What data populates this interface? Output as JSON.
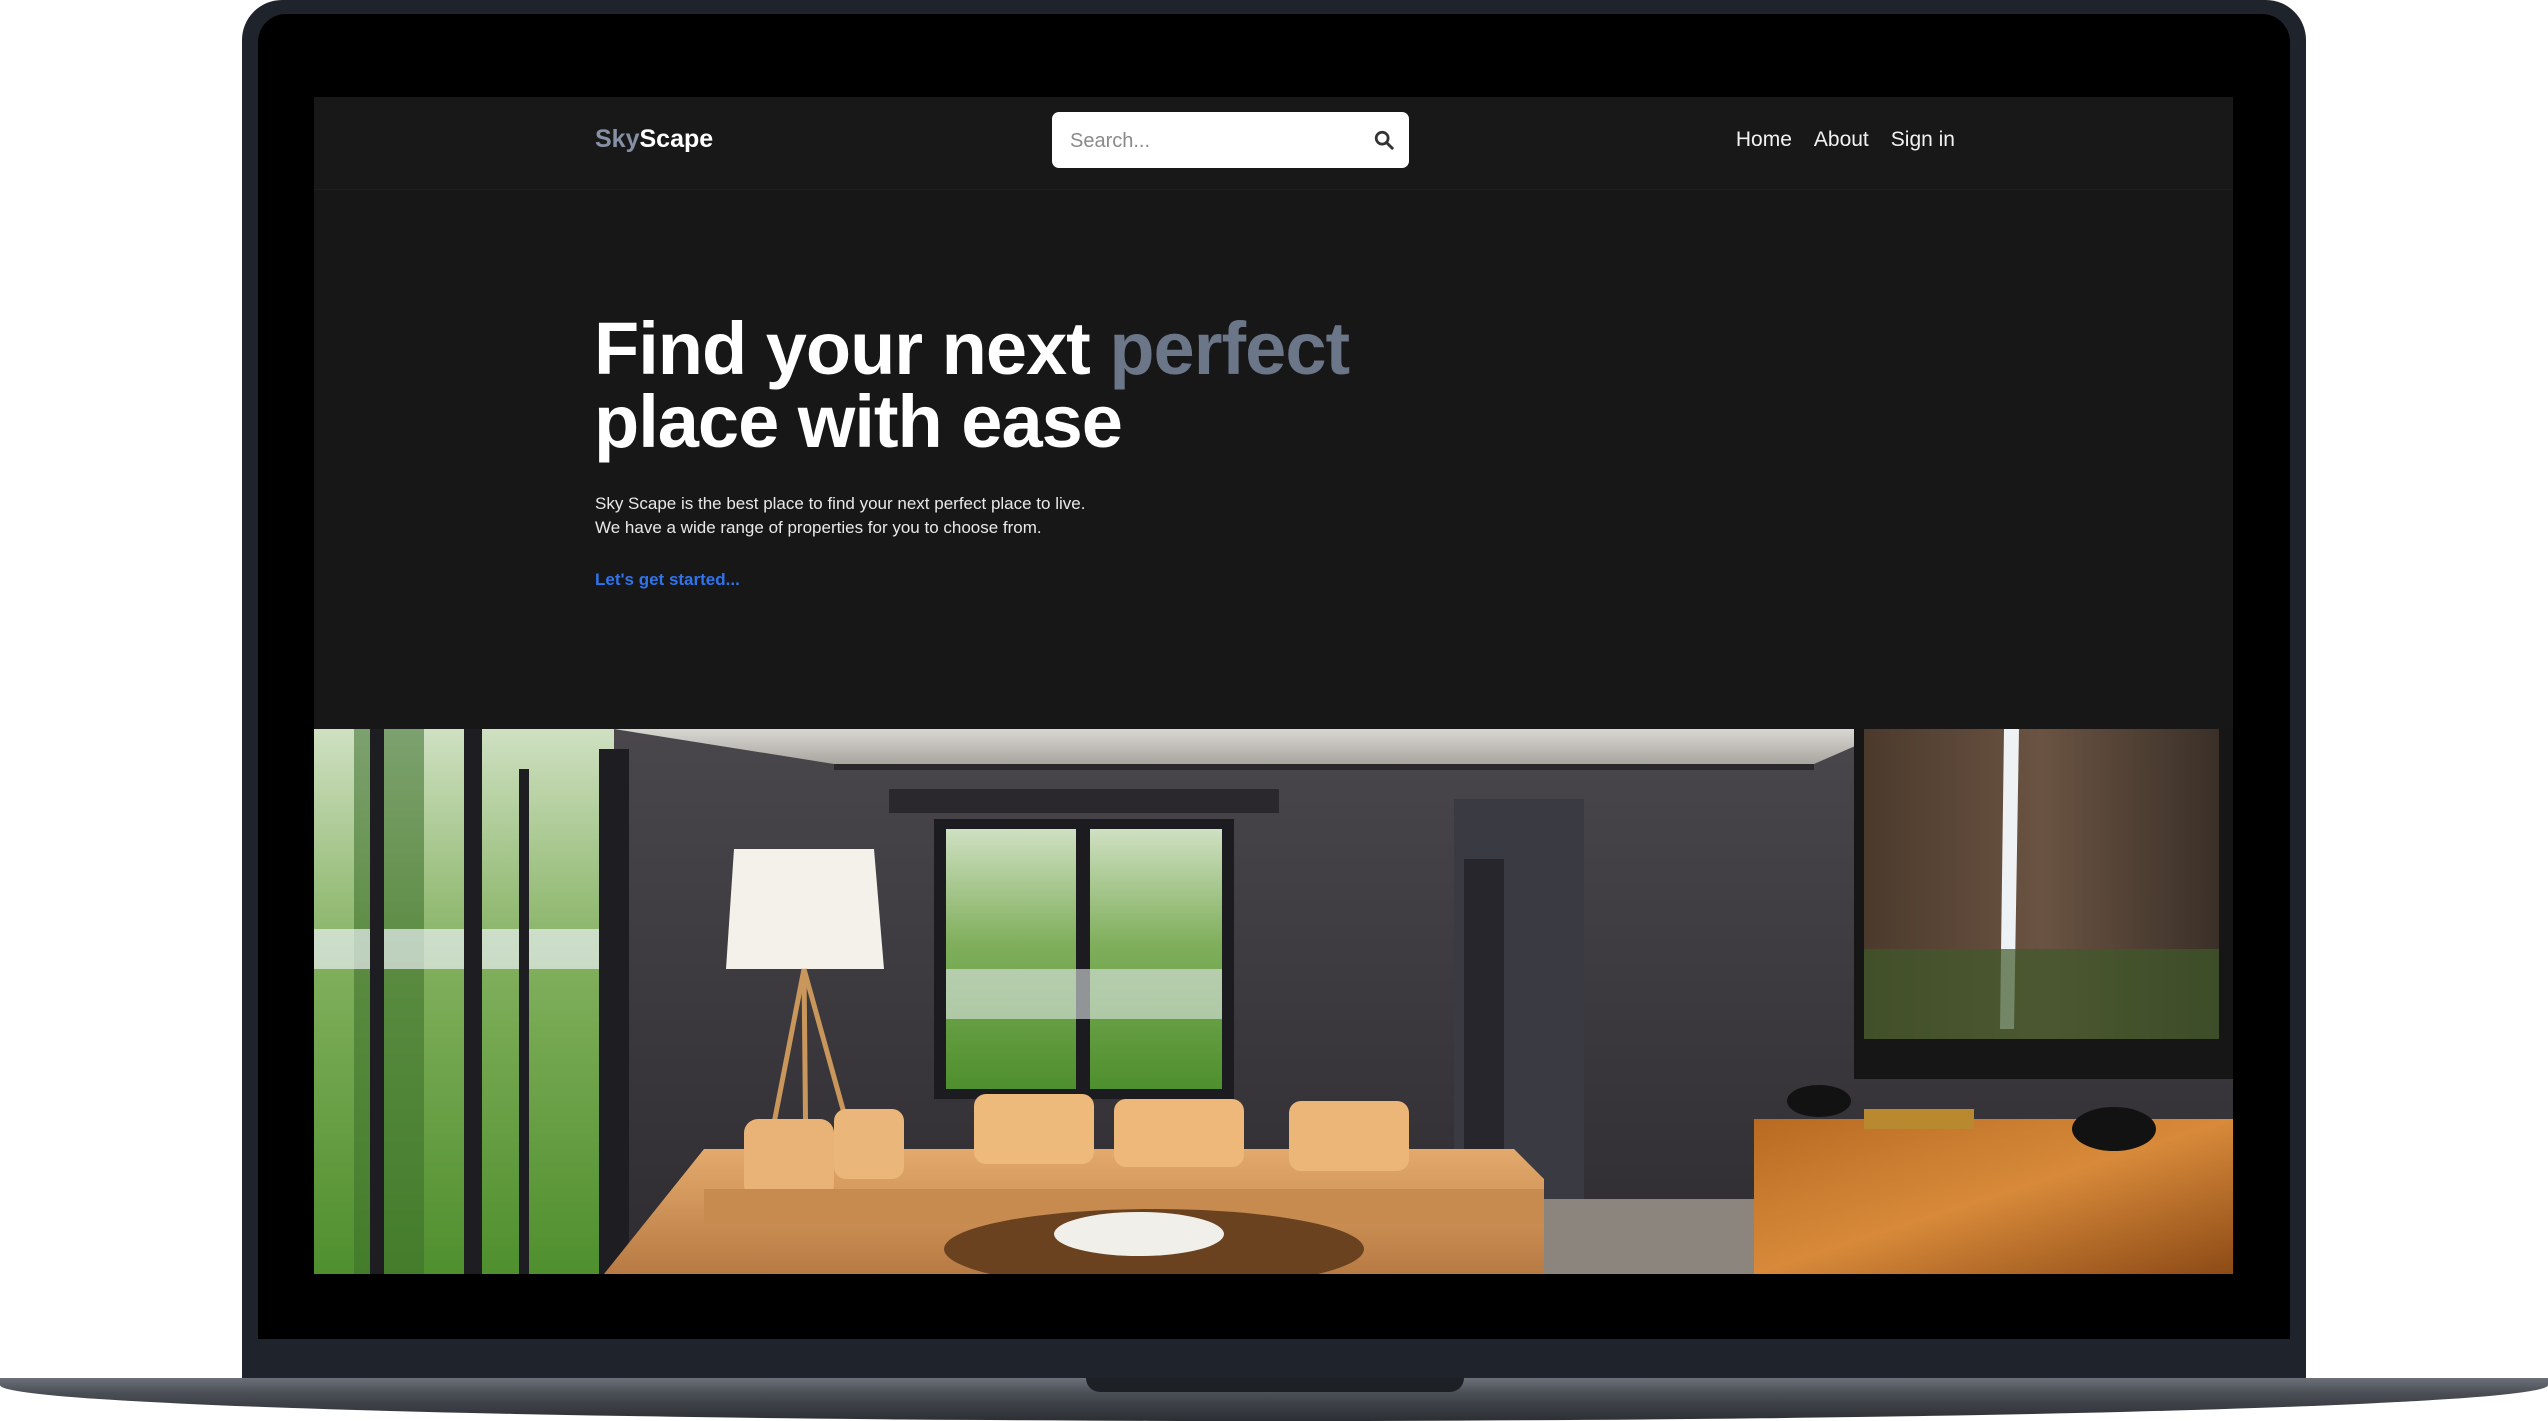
{
  "navbar": {
    "brand_part1": "Sky",
    "brand_part2": "Scape",
    "search_placeholder": "Search...",
    "links": [
      {
        "label": "Home"
      },
      {
        "label": "About"
      },
      {
        "label": "Sign in"
      }
    ]
  },
  "hero": {
    "title_part1": "Find your next ",
    "title_accent": "perfect",
    "title_part2": "place with ease",
    "description_line1": "Sky Scape is the best place to find your next perfect place to live.",
    "description_line2": "We have a wide range of properties for you to choose from.",
    "cta_label": "Let's get started..."
  },
  "colors": {
    "page_background": "#171717",
    "brand_accent": "#8590a5",
    "title_accent": "#6b7689",
    "link_blue": "#2f74ee"
  },
  "icons": {
    "search": "search-icon"
  }
}
